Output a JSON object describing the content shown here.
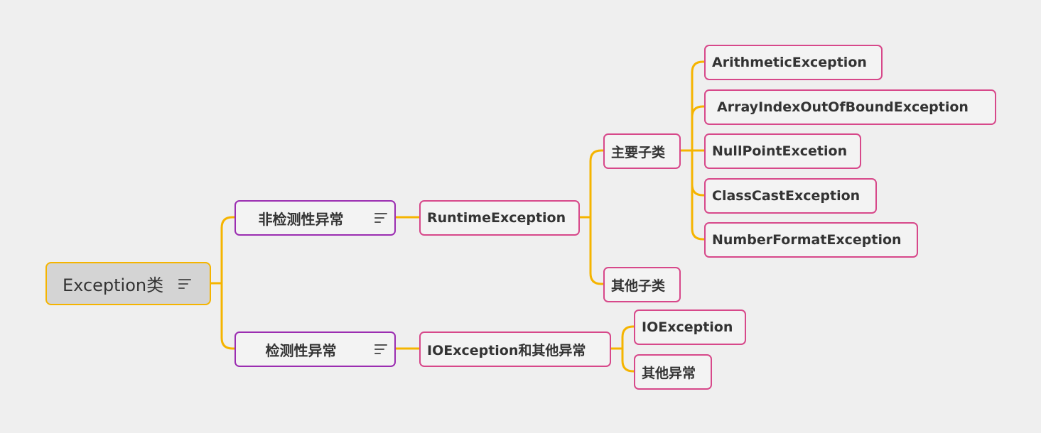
{
  "root": {
    "label": "Exception类",
    "has_note": true
  },
  "branches": [
    {
      "label": "非检测性异常",
      "has_note": true,
      "child": {
        "label": "RuntimeException",
        "children": [
          {
            "label": "主要子类",
            "children": [
              "ArithmeticException",
              "ArrayIndexOutOfBoundException",
              "NullPointExcetion",
              "ClassCastException",
              "NumberFormatException"
            ]
          },
          {
            "label": "其他子类",
            "children": []
          }
        ]
      }
    },
    {
      "label": "检测性异常",
      "has_note": true,
      "child": {
        "label": "IOException和其他异常",
        "children": [
          {
            "label": "IOException",
            "children": []
          },
          {
            "label": "其他异常",
            "children": []
          }
        ]
      }
    }
  ],
  "colors": {
    "background": "#efefef",
    "connector": "#f5b400",
    "root_fill": "#d4d4d4",
    "root_border": "#f5b400",
    "level1_border": "#9b2db1",
    "level2_border": "#d7488a",
    "text": "#333333"
  }
}
